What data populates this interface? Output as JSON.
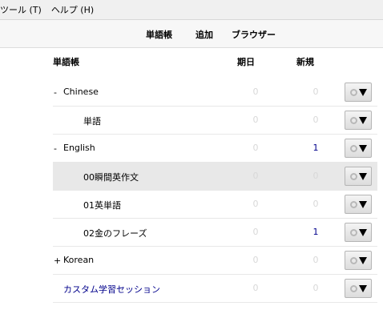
{
  "menubar": {
    "items": [
      "ツール (T)",
      "ヘルプ (H)"
    ]
  },
  "topnav": {
    "decks": "単語帳",
    "add": "追加",
    "browse": "ブラウザー"
  },
  "headers": {
    "deck": "単語帳",
    "due": "期日",
    "new": "新規"
  },
  "decks": [
    {
      "expander": "-",
      "name": "Chinese",
      "due": "0",
      "new": "0",
      "indent": 0,
      "current": false,
      "filtered": false,
      "new_active": false
    },
    {
      "expander": "",
      "name": "単語",
      "due": "0",
      "new": "0",
      "indent": 1,
      "current": false,
      "filtered": false,
      "new_active": false
    },
    {
      "expander": "-",
      "name": "English",
      "due": "0",
      "new": "1",
      "indent": 0,
      "current": false,
      "filtered": false,
      "new_active": true
    },
    {
      "expander": "",
      "name": "00瞬間英作文",
      "due": "0",
      "new": "0",
      "indent": 1,
      "current": true,
      "filtered": false,
      "new_active": false
    },
    {
      "expander": "",
      "name": "01英単語",
      "due": "0",
      "new": "0",
      "indent": 1,
      "current": false,
      "filtered": false,
      "new_active": false
    },
    {
      "expander": "",
      "name": "02金のフレーズ",
      "due": "0",
      "new": "1",
      "indent": 1,
      "current": false,
      "filtered": false,
      "new_active": true
    },
    {
      "expander": "+",
      "name": "Korean",
      "due": "0",
      "new": "0",
      "indent": 0,
      "current": false,
      "filtered": false,
      "new_active": false
    },
    {
      "expander": "",
      "name": "カスタム学習セッション",
      "due": "0",
      "new": "0",
      "indent": 0,
      "current": false,
      "filtered": true,
      "new_active": false
    }
  ],
  "colors": {
    "new_count": "#00008b",
    "zero_count": "#d8d8d8",
    "filtered_deck": "#00008b",
    "current_row": "#e8e8e8"
  },
  "icons": {
    "options": "gear-icon"
  }
}
